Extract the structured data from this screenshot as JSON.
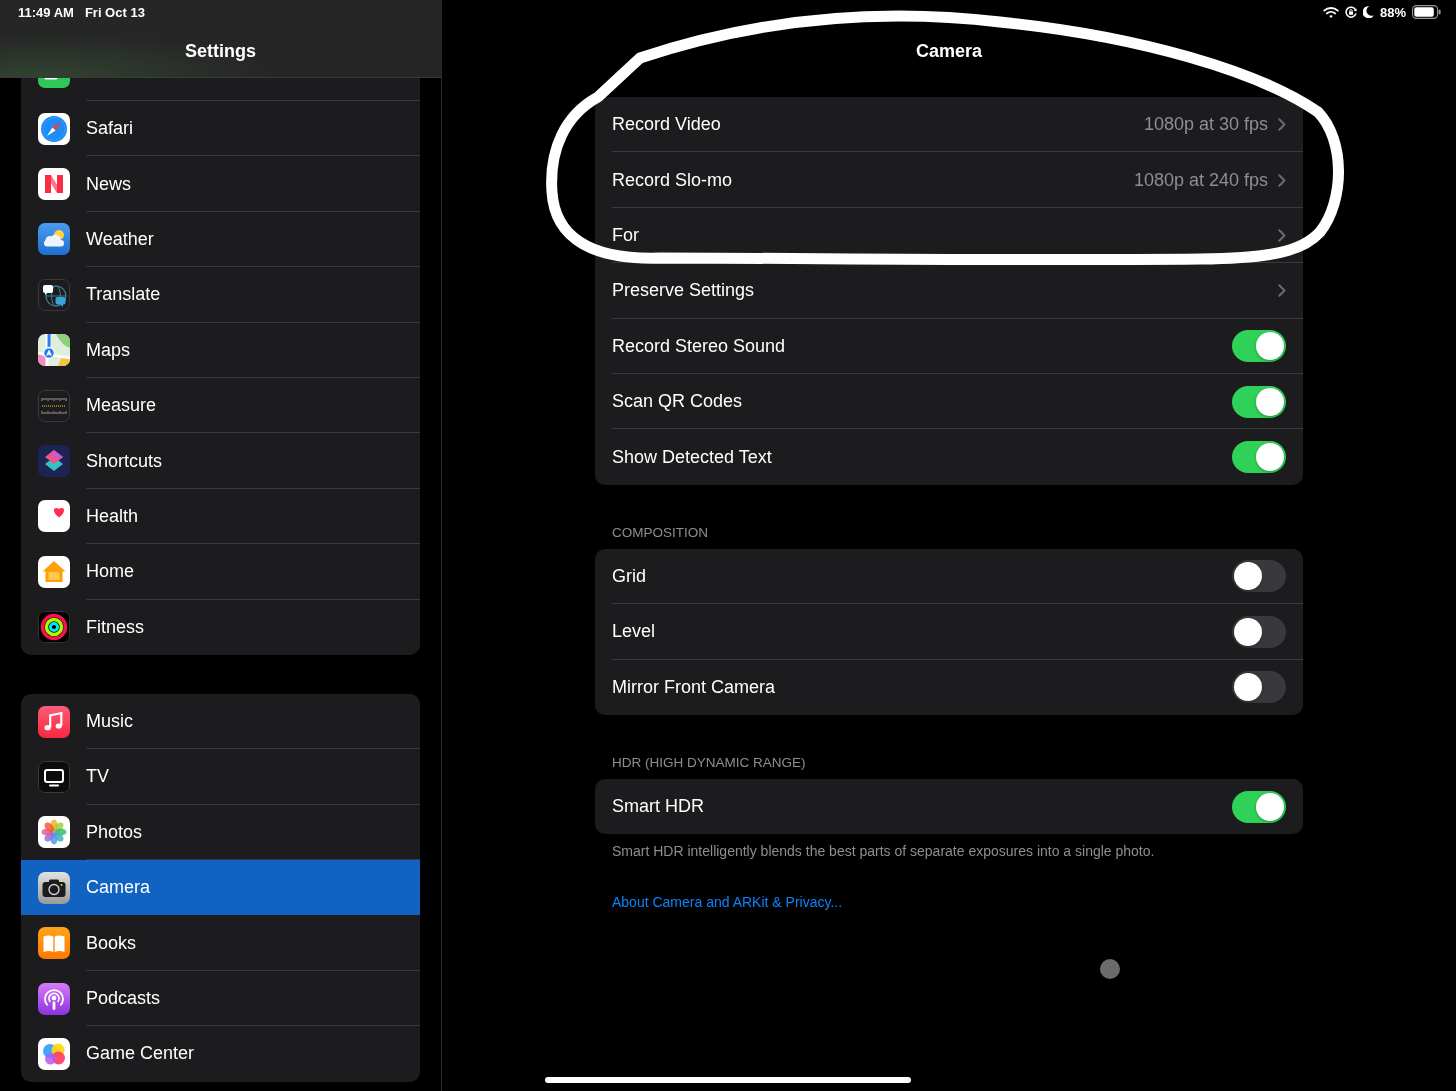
{
  "status_bar": {
    "time": "11:49 AM",
    "date": "Fri Oct 13",
    "battery": "88%"
  },
  "sidebar": {
    "title": "Settings",
    "groups": [
      {
        "first_row_cut_off": true,
        "items": [
          {
            "label": "Safari",
            "selected": false
          },
          {
            "label": "News",
            "selected": false
          },
          {
            "label": "Weather",
            "selected": false
          },
          {
            "label": "Translate",
            "selected": false
          },
          {
            "label": "Maps",
            "selected": false
          },
          {
            "label": "Measure",
            "selected": false
          },
          {
            "label": "Shortcuts",
            "selected": false
          },
          {
            "label": "Health",
            "selected": false
          },
          {
            "label": "Home",
            "selected": false
          },
          {
            "label": "Fitness",
            "selected": false
          }
        ]
      },
      {
        "first_row_cut_off": false,
        "items": [
          {
            "label": "Music",
            "selected": false
          },
          {
            "label": "TV",
            "selected": false
          },
          {
            "label": "Photos",
            "selected": false
          },
          {
            "label": "Camera",
            "selected": true
          },
          {
            "label": "Books",
            "selected": false
          },
          {
            "label": "Podcasts",
            "selected": false
          },
          {
            "label": "Game Center",
            "selected": false
          }
        ]
      }
    ]
  },
  "detail": {
    "title": "Camera",
    "sections": [
      {
        "rows": [
          {
            "kind": "link",
            "label": "Record Video",
            "value": "1080p at 30 fps"
          },
          {
            "kind": "link",
            "label": "Record Slo-mo",
            "value": "1080p at 240 fps"
          },
          {
            "kind": "link",
            "label": "For"
          },
          {
            "kind": "link",
            "label": "Preserve Settings"
          },
          {
            "kind": "toggle",
            "label": "Record Stereo Sound",
            "on": true
          },
          {
            "kind": "toggle",
            "label": "Scan QR Codes",
            "on": true
          },
          {
            "kind": "toggle",
            "label": "Show Detected Text",
            "on": true
          }
        ]
      },
      {
        "header": "COMPOSITION",
        "rows": [
          {
            "kind": "toggle",
            "label": "Grid",
            "on": false
          },
          {
            "kind": "toggle",
            "label": "Level",
            "on": false
          },
          {
            "kind": "toggle",
            "label": "Mirror Front Camera",
            "on": false
          }
        ]
      },
      {
        "header": "HDR (HIGH DYNAMIC RANGE)",
        "rows": [
          {
            "kind": "toggle",
            "label": "Smart HDR",
            "on": true
          }
        ],
        "footer": "Smart HDR intelligently blends the best parts of separate exposures into a single photo."
      }
    ],
    "link": "About Camera and ARKit & Privacy..."
  },
  "annotations": [
    {
      "kind": "loop"
    }
  ]
}
